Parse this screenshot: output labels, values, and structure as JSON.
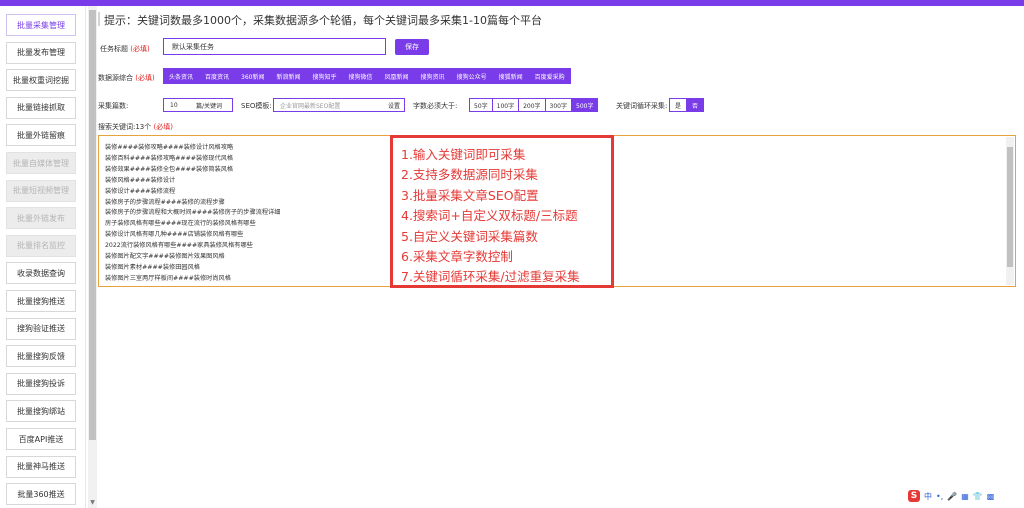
{
  "sidebar": {
    "items": [
      {
        "label": "批量采集管理",
        "state": "active"
      },
      {
        "label": "批量发布管理",
        "state": "normal"
      },
      {
        "label": "批量权重词挖掘",
        "state": "normal"
      },
      {
        "label": "批量链接抓取",
        "state": "normal"
      },
      {
        "label": "批量外链留痕",
        "state": "normal"
      },
      {
        "label": "批量自媒体管理",
        "state": "disabled"
      },
      {
        "label": "批量短视频管理",
        "state": "disabled"
      },
      {
        "label": "批量外链发布",
        "state": "disabled"
      },
      {
        "label": "批量排名监控",
        "state": "disabled"
      },
      {
        "label": "收录数据查询",
        "state": "normal"
      },
      {
        "label": "批量搜狗推送",
        "state": "normal"
      },
      {
        "label": "搜狗验证推送",
        "state": "normal"
      },
      {
        "label": "批量搜狗反馈",
        "state": "normal"
      },
      {
        "label": "批量搜狗投诉",
        "state": "normal"
      },
      {
        "label": "批量搜狗绑站",
        "state": "normal"
      },
      {
        "label": "百度API推送",
        "state": "normal"
      },
      {
        "label": "批量神马推送",
        "state": "normal"
      },
      {
        "label": "批量360推送",
        "state": "normal"
      }
    ]
  },
  "hint": "提示：关键词数最多1000个，采集数据源多个轮循，每个关键词最多采集1-10篇每个平台",
  "task": {
    "label": "任务标题",
    "required": "(必填)",
    "value": "默认采集任务",
    "save": "保存"
  },
  "sources": {
    "label": "数据源综合",
    "required": "(必填)",
    "items": [
      "头条资讯",
      "百度资讯",
      "360新闻",
      "新浪新闻",
      "搜狗知乎",
      "搜狗微信",
      "凤凰新闻",
      "搜狗资讯",
      "搜狗公众号",
      "搜狐新闻",
      "百度爱采购"
    ]
  },
  "options": {
    "count_label": "采集篇数:",
    "count_value": "10",
    "count_unit": "篇/关键词",
    "seo_label": "SEO模板:",
    "seo_placeholder": "企业官网最新SEO配置",
    "seo_button": "设置",
    "words_label": "字数必须大于:",
    "words_options": [
      "50字",
      "100字",
      "200字",
      "300字",
      "500字"
    ],
    "words_selected": 4,
    "loop_label": "关键词循环采集:",
    "loop_options": [
      "是",
      "否"
    ],
    "loop_selected": 1
  },
  "keywords": {
    "label": "搜索关键词:13个",
    "required": "(必填)",
    "lines": [
      "装修####装修攻略####装修设计风格攻略",
      "装修百科####装修攻略####装修现代风格",
      "装修效果####装修全包####装修简装风格",
      "装修风格####装修设计",
      "装修设计####装修流程",
      "装修房子的步骤流程####装修的流程步骤",
      "装修房子的步骤流程和大概时间####装修房子的步骤流程详细",
      "房子装修风格有哪些####现在流行的装修风格有哪些",
      "装修设计风格有哪几种####店铺装修风格有哪些",
      "2022流行装修风格有哪些####家具装修风格有哪些",
      "装修图片配文字####装修图片效果图风格",
      "装修图片素材####装修田园风格",
      "装修图片三室两厅样板间####装修时尚风格"
    ]
  },
  "callout": {
    "lines": [
      "1.输入关键词即可采集",
      "2.支持多数据源同时采集",
      "3.批量采集文章SEO配置",
      "4.搜索词+自定义双标题/三标题",
      "5.自定义关键词采集篇数",
      "6.采集文章字数控制",
      "7.关键词循环采集/过滤重复采集"
    ]
  },
  "ime": {
    "logo": "S",
    "items": [
      "中",
      "•,",
      "🎤",
      "▦",
      "👕",
      "▩"
    ]
  },
  "colors": {
    "accent": "#7a3ce8",
    "required": "#e02020",
    "callout": "#e53935",
    "textarea_border": "#e6a23c"
  }
}
